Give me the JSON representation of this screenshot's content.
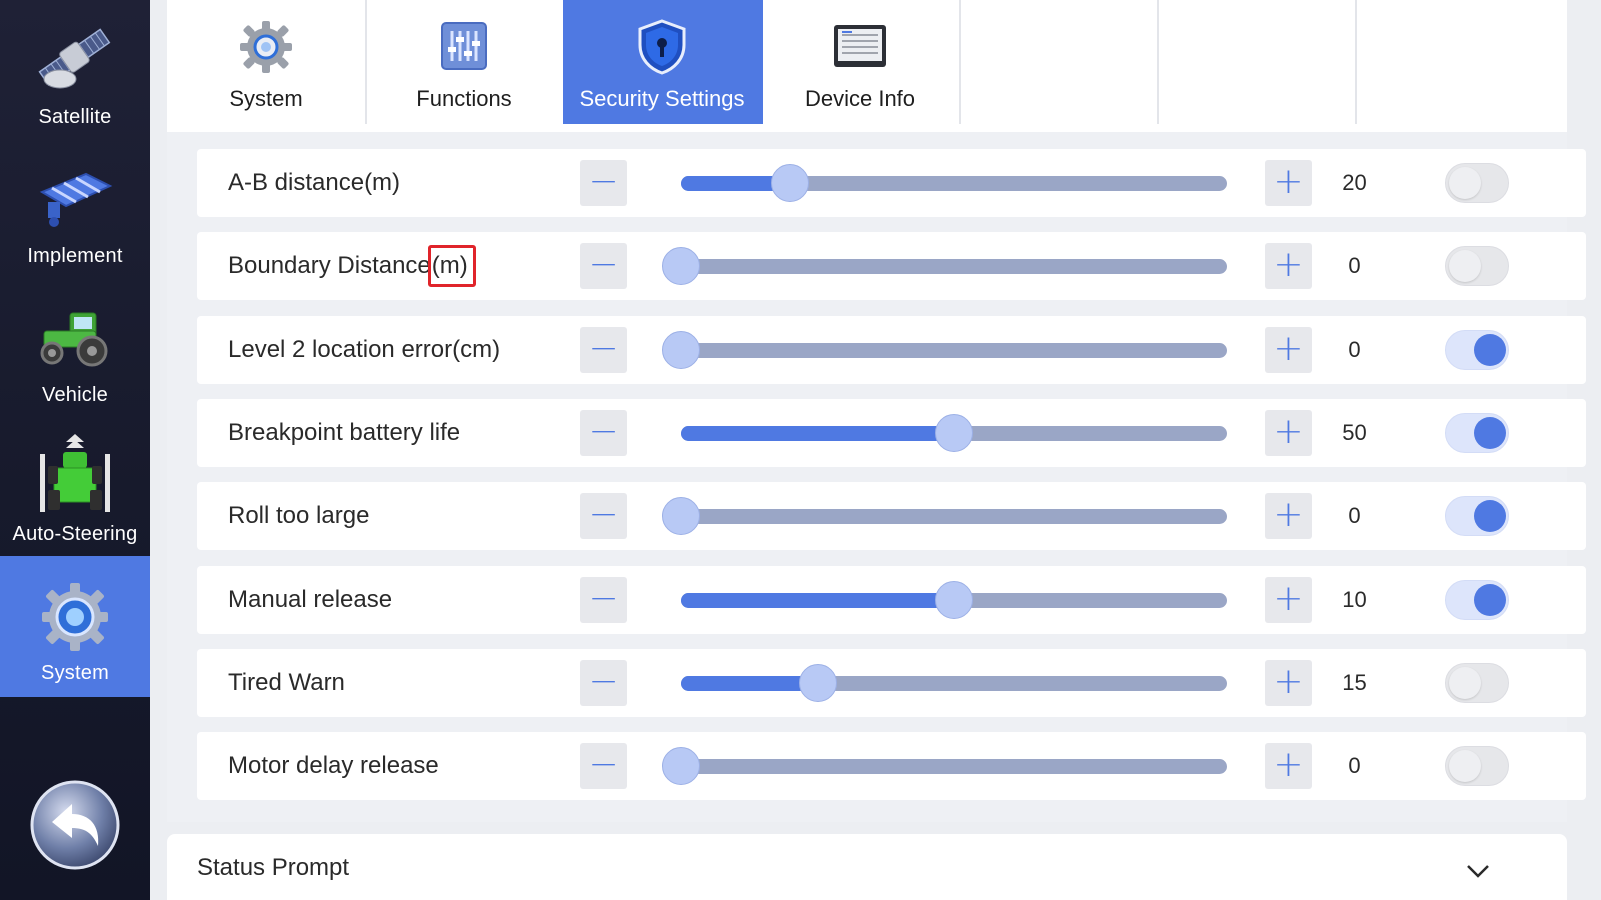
{
  "sidebar": {
    "items": [
      {
        "label": "Satellite",
        "icon": "satellite-icon",
        "active": false
      },
      {
        "label": "Implement",
        "icon": "implement-icon",
        "active": false
      },
      {
        "label": "Vehicle",
        "icon": "tractor-icon",
        "active": false
      },
      {
        "label": "Auto-Steering",
        "icon": "auto-steering-icon",
        "active": false
      },
      {
        "label": "System",
        "icon": "system-gear-icon",
        "active": true
      }
    ],
    "back_icon": "back-arrow-icon"
  },
  "tabs": [
    {
      "label": "System",
      "icon": "gear-icon",
      "active": false
    },
    {
      "label": "Functions",
      "icon": "sliders-icon",
      "active": false
    },
    {
      "label": "Security Settings",
      "icon": "shield-lock-icon",
      "active": true
    },
    {
      "label": "Device Info",
      "icon": "monitor-icon",
      "active": false
    },
    {
      "label": "",
      "active": false
    },
    {
      "label": "",
      "active": false
    },
    {
      "label": "",
      "active": false
    }
  ],
  "settings": [
    {
      "label": "A-B distance(m)",
      "value": "20",
      "level": 0.2,
      "enabled": false
    },
    {
      "label_main": "Boundary Distance",
      "label_highlight": "(m)",
      "value": "0",
      "level": 0.0,
      "enabled": false
    },
    {
      "label": "Level 2 location error(cm)",
      "value": "0",
      "level": 0.0,
      "enabled": true
    },
    {
      "label": "Breakpoint battery life",
      "value": "50",
      "level": 0.5,
      "enabled": true
    },
    {
      "label": "Roll too large",
      "value": "0",
      "level": 0.0,
      "enabled": true
    },
    {
      "label": "Manual release",
      "value": "10",
      "level": 0.5,
      "enabled": true
    },
    {
      "label": "Tired Warn",
      "value": "15",
      "level": 0.25,
      "enabled": false
    },
    {
      "label": "Motor delay release",
      "value": "0",
      "level": 0.0,
      "enabled": false
    }
  ],
  "controls": {
    "minus": "−",
    "plus": "+"
  },
  "status_prompt": {
    "label": "Status Prompt",
    "icon": "chevron-down-icon"
  },
  "colors": {
    "accent": "#4f79e2",
    "sidebar_bg": "#1a1d30",
    "track": "#9aa6c6",
    "highlight_border": "#e0242a"
  }
}
